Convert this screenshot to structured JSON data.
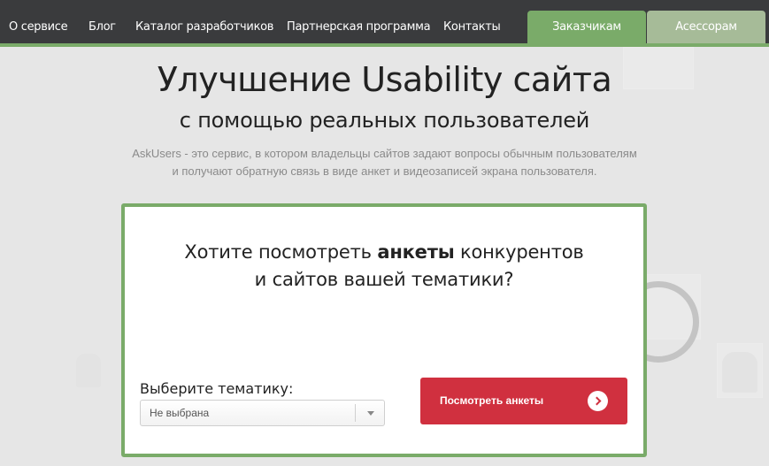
{
  "nav": {
    "links": [
      "О сервисе",
      "Блог",
      "Каталог разработчиков",
      "Партнерская программа",
      "Контакты"
    ],
    "tabs": [
      "Заказчикам",
      "Асессорам"
    ]
  },
  "hero": {
    "title": "Улучшение Usability сайта",
    "subtitle": "с помощью реальных пользователей",
    "description_line1": "AskUsers - это сервис, в котором владельцы сайтов задают вопросы обычным пользователям",
    "description_line2": "и получают обратную связь в виде анкет и видеозаписей экрана пользователя."
  },
  "card": {
    "question_before": "Хотите посмотреть ",
    "question_bold": "анкеты",
    "question_after": " конкурентов",
    "question_line2": "и сайтов вашей тематики?",
    "select_label": "Выберите тематику:",
    "select_value": "Не выбрана",
    "button_label": "Посмотреть анкеты"
  },
  "colors": {
    "accent_green": "#7aab69",
    "button_red": "#d0303f",
    "nav_background": "#3a3b3d"
  },
  "icons": {
    "cta": "arrow-right-circle-icon",
    "select": "chevron-down-icon"
  }
}
